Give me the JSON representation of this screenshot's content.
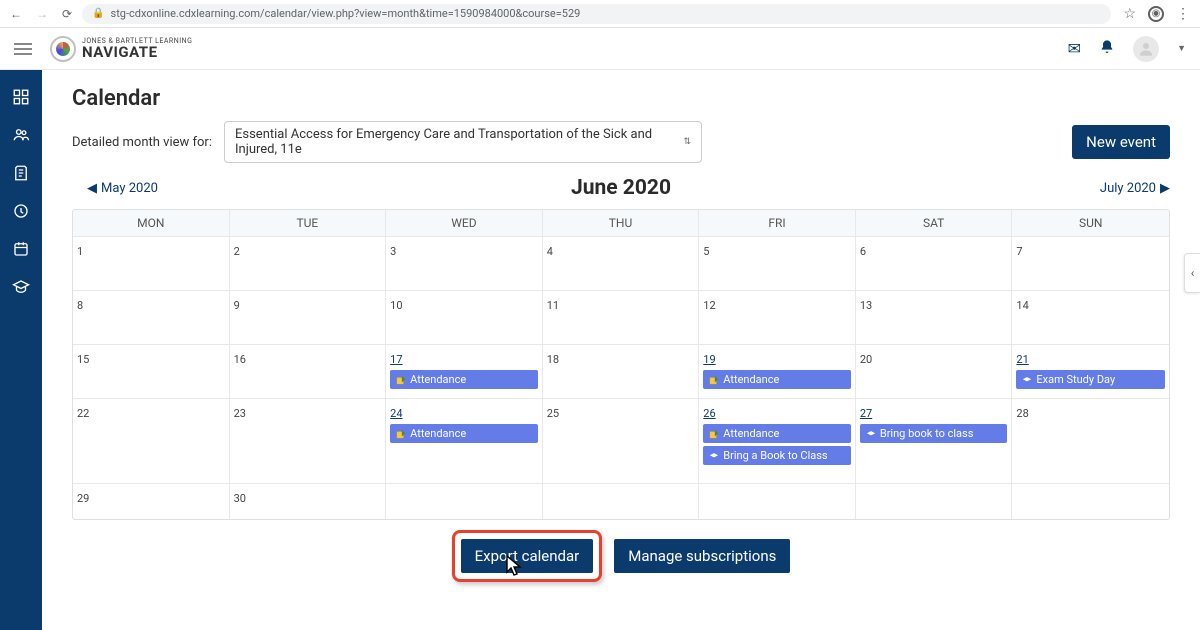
{
  "browser": {
    "url": "stg-cdxonline.cdxlearning.com/calendar/view.php?view=month&time=1590984000&course=529"
  },
  "brand": {
    "tagline": "JONES & BARTLETT LEARNING",
    "product": "NAVIGATE"
  },
  "page": {
    "title": "Calendar",
    "filterLabel": "Detailed month view for:",
    "courseName": "Essential Access for Emergency Care and Transportation of the Sick and Injured, 11e",
    "newEvent": "New event",
    "prevMonth": "May 2020",
    "currentMonth": "June 2020",
    "nextMonth": "July 2020",
    "exportLabel": "Export calendar",
    "manageLabel": "Manage subscriptions"
  },
  "days": [
    "MON",
    "TUE",
    "WED",
    "THU",
    "FRI",
    "SAT",
    "SUN"
  ],
  "events": {
    "attendance": "Attendance",
    "examStudy": "Exam Study Day",
    "bringBookClass": "Bring a Book to Class",
    "bringBook": "Bring book to class"
  },
  "nums": {
    "r1": [
      "1",
      "2",
      "3",
      "4",
      "5",
      "6",
      "7"
    ],
    "r2": [
      "8",
      "9",
      "10",
      "11",
      "12",
      "13",
      "14"
    ],
    "r3": [
      "15",
      "16",
      "17",
      "18",
      "19",
      "20",
      "21"
    ],
    "r4": [
      "22",
      "23",
      "24",
      "25",
      "26",
      "27",
      "28"
    ],
    "r5": [
      "29",
      "30",
      "",
      "",
      "",
      "",
      ""
    ]
  }
}
